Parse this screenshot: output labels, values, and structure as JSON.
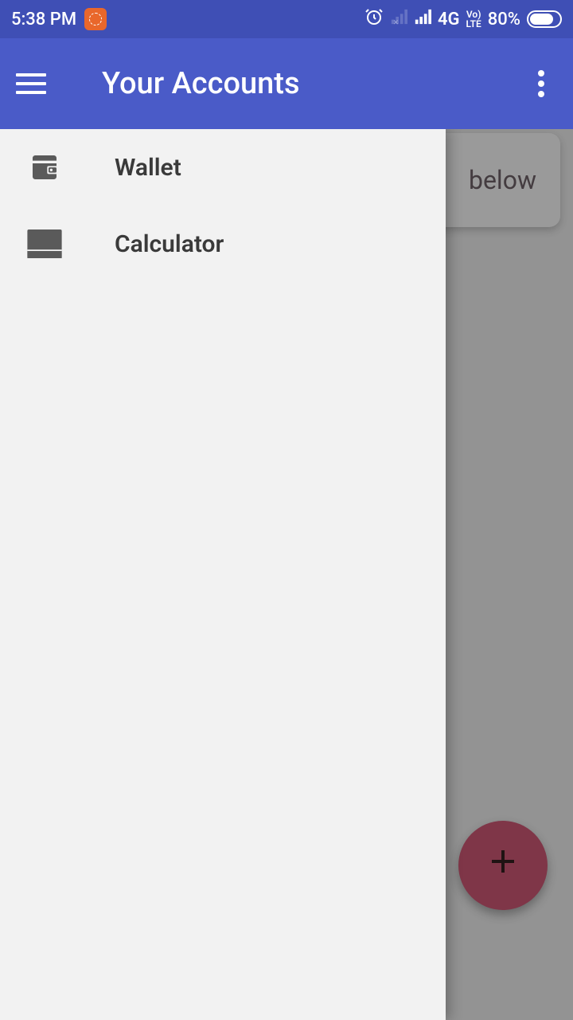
{
  "status_bar": {
    "time": "5:38 PM",
    "network_type": "4G",
    "volte_top": "Vo)",
    "volte_bottom": "LTE",
    "battery_percent": "80%"
  },
  "app_bar": {
    "title": "Your Accounts"
  },
  "hint_card": {
    "text_fragment": "below"
  },
  "drawer": {
    "items": [
      {
        "label": "Wallet"
      },
      {
        "label": "Calculator"
      }
    ]
  }
}
